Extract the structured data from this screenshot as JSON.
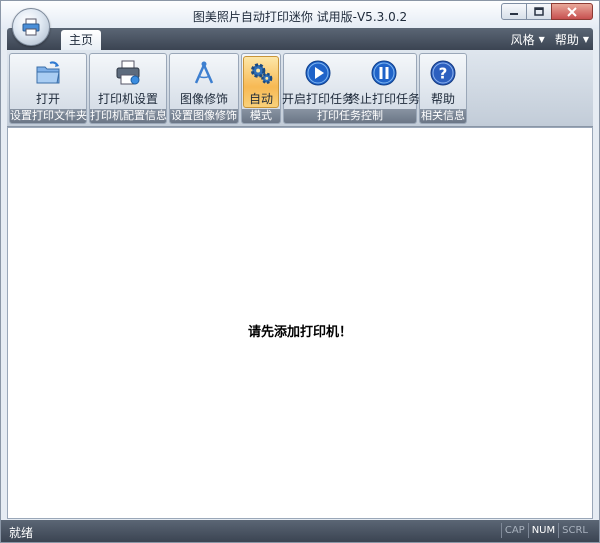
{
  "window": {
    "title": "图美照片自动打印迷你 试用版-V5.3.0.2",
    "controls": {
      "minimize_icon": "minimize-icon",
      "restore_icon": "restore-icon",
      "close_icon": "close-icon"
    }
  },
  "tabs": {
    "home": "主页"
  },
  "menu": {
    "style": "风格",
    "help": "帮助"
  },
  "ribbon": {
    "groups": [
      {
        "label": "设置打印文件夹",
        "buttons": [
          {
            "label": "打开",
            "icon": "folder-open-icon"
          }
        ]
      },
      {
        "label": "打印机配置信息",
        "buttons": [
          {
            "label": "打印机设置",
            "icon": "printer-settings-icon"
          }
        ]
      },
      {
        "label": "设置图像修饰",
        "buttons": [
          {
            "label": "图像修饰",
            "icon": "compass-icon"
          }
        ]
      },
      {
        "label": "模式",
        "buttons": [
          {
            "label": "自动",
            "icon": "gears-icon",
            "active": true
          }
        ]
      },
      {
        "label": "打印任务控制",
        "buttons": [
          {
            "label": "开启打印任务",
            "icon": "play-icon"
          },
          {
            "label": "终止打印任务",
            "icon": "pause-icon"
          }
        ]
      },
      {
        "label": "相关信息",
        "buttons": [
          {
            "label": "帮助",
            "icon": "help-icon"
          }
        ]
      }
    ]
  },
  "content": {
    "message": "请先添加打印机！"
  },
  "status": {
    "text": "就绪",
    "indicators": [
      {
        "label": "CAP",
        "on": false
      },
      {
        "label": "NUM",
        "on": true
      },
      {
        "label": "SCRL",
        "on": false
      }
    ]
  },
  "colors": {
    "accent_active": "#f7b954",
    "dark_bar": "#3b4452",
    "play_blue": "#1f63c9"
  }
}
